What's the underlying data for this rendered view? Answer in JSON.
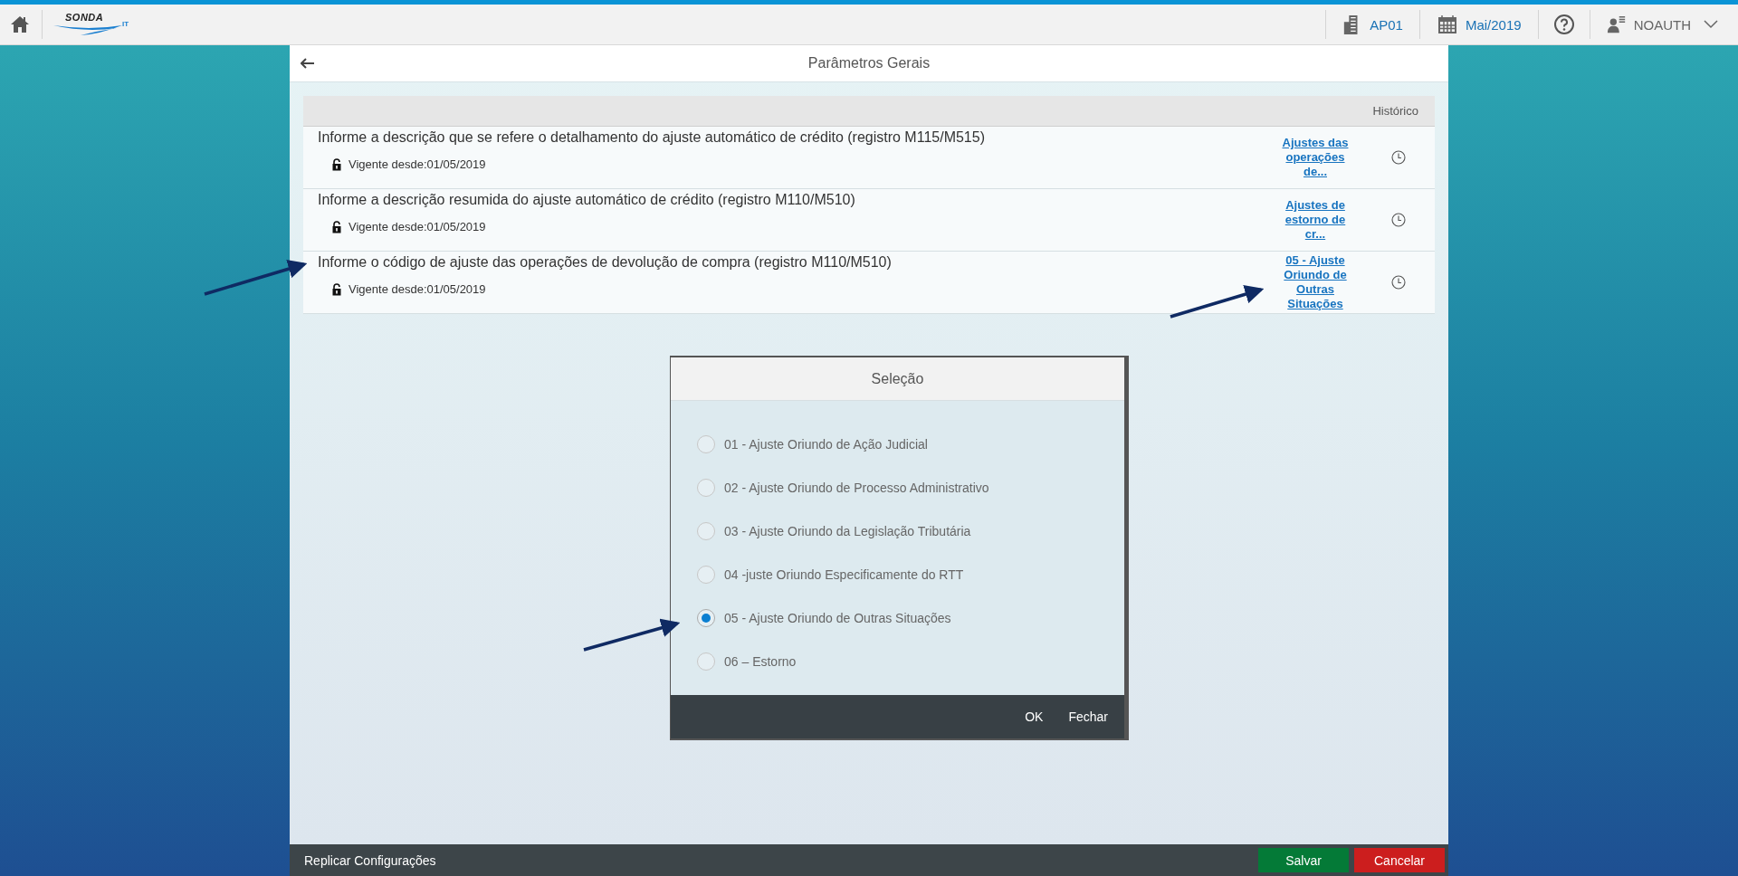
{
  "header": {
    "logo_text": "SONDA",
    "logo_suffix": "IT",
    "company": "AP01",
    "period": "Mai/2019",
    "user": "NOAUTH"
  },
  "page": {
    "title": "Parâmetros Gerais"
  },
  "table": {
    "columns": [
      "Histórico"
    ],
    "rows": [
      {
        "description": "Informe a descrição que se refere o detalhamento do ajuste automático de crédito (registro M115/M515)",
        "validity": "Vigente desde:01/05/2019",
        "value": "Ajustes das operações de..."
      },
      {
        "description": "Informe a descrição resumida do ajuste automático de crédito (registro M110/M510)",
        "validity": "Vigente desde:01/05/2019",
        "value": "Ajustes de estorno de cr..."
      },
      {
        "description": "Informe o código de ajuste das operações de devolução de compra (registro M110/M510)",
        "validity": "Vigente desde:01/05/2019",
        "value": "05 - Ajuste Oriundo de Outras Situações"
      }
    ]
  },
  "dialog": {
    "title": "Seleção",
    "options": [
      {
        "label": "01 - Ajuste Oriundo de Ação Judicial",
        "selected": false
      },
      {
        "label": "02 - Ajuste Oriundo de Processo Administrativo",
        "selected": false
      },
      {
        "label": "03 - Ajuste Oriundo da Legislação Tributária",
        "selected": false
      },
      {
        "label": "04 -juste Oriundo Especificamente do RTT",
        "selected": false
      },
      {
        "label": "05 - Ajuste Oriundo de Outras Situações",
        "selected": true
      },
      {
        "label": "06 – Estorno",
        "selected": false
      }
    ],
    "buttons": [
      "OK",
      "Fechar"
    ]
  },
  "footer": {
    "link": "Replicar Configurações",
    "buttons": [
      {
        "label": "Salvar",
        "kind": "save"
      },
      {
        "label": "Cancelar",
        "kind": "cancel"
      }
    ]
  }
}
